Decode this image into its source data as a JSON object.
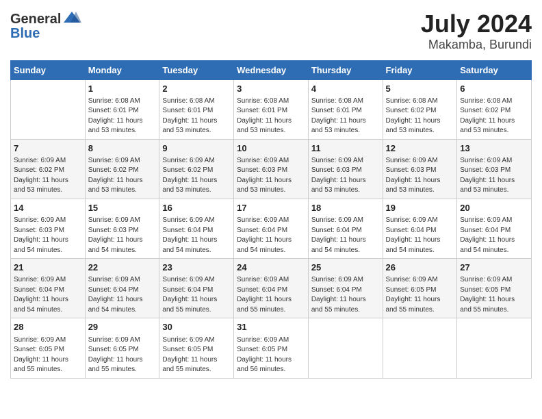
{
  "header": {
    "logo_general": "General",
    "logo_blue": "Blue",
    "month_year": "July 2024",
    "location": "Makamba, Burundi"
  },
  "days_of_week": [
    "Sunday",
    "Monday",
    "Tuesday",
    "Wednesday",
    "Thursday",
    "Friday",
    "Saturday"
  ],
  "weeks": [
    {
      "days": [
        {
          "num": "",
          "info": ""
        },
        {
          "num": "1",
          "info": "Sunrise: 6:08 AM\nSunset: 6:01 PM\nDaylight: 11 hours\nand 53 minutes."
        },
        {
          "num": "2",
          "info": "Sunrise: 6:08 AM\nSunset: 6:01 PM\nDaylight: 11 hours\nand 53 minutes."
        },
        {
          "num": "3",
          "info": "Sunrise: 6:08 AM\nSunset: 6:01 PM\nDaylight: 11 hours\nand 53 minutes."
        },
        {
          "num": "4",
          "info": "Sunrise: 6:08 AM\nSunset: 6:01 PM\nDaylight: 11 hours\nand 53 minutes."
        },
        {
          "num": "5",
          "info": "Sunrise: 6:08 AM\nSunset: 6:02 PM\nDaylight: 11 hours\nand 53 minutes."
        },
        {
          "num": "6",
          "info": "Sunrise: 6:08 AM\nSunset: 6:02 PM\nDaylight: 11 hours\nand 53 minutes."
        }
      ]
    },
    {
      "days": [
        {
          "num": "7",
          "info": "Sunrise: 6:09 AM\nSunset: 6:02 PM\nDaylight: 11 hours\nand 53 minutes."
        },
        {
          "num": "8",
          "info": "Sunrise: 6:09 AM\nSunset: 6:02 PM\nDaylight: 11 hours\nand 53 minutes."
        },
        {
          "num": "9",
          "info": "Sunrise: 6:09 AM\nSunset: 6:02 PM\nDaylight: 11 hours\nand 53 minutes."
        },
        {
          "num": "10",
          "info": "Sunrise: 6:09 AM\nSunset: 6:03 PM\nDaylight: 11 hours\nand 53 minutes."
        },
        {
          "num": "11",
          "info": "Sunrise: 6:09 AM\nSunset: 6:03 PM\nDaylight: 11 hours\nand 53 minutes."
        },
        {
          "num": "12",
          "info": "Sunrise: 6:09 AM\nSunset: 6:03 PM\nDaylight: 11 hours\nand 53 minutes."
        },
        {
          "num": "13",
          "info": "Sunrise: 6:09 AM\nSunset: 6:03 PM\nDaylight: 11 hours\nand 53 minutes."
        }
      ]
    },
    {
      "days": [
        {
          "num": "14",
          "info": "Sunrise: 6:09 AM\nSunset: 6:03 PM\nDaylight: 11 hours\nand 54 minutes."
        },
        {
          "num": "15",
          "info": "Sunrise: 6:09 AM\nSunset: 6:03 PM\nDaylight: 11 hours\nand 54 minutes."
        },
        {
          "num": "16",
          "info": "Sunrise: 6:09 AM\nSunset: 6:04 PM\nDaylight: 11 hours\nand 54 minutes."
        },
        {
          "num": "17",
          "info": "Sunrise: 6:09 AM\nSunset: 6:04 PM\nDaylight: 11 hours\nand 54 minutes."
        },
        {
          "num": "18",
          "info": "Sunrise: 6:09 AM\nSunset: 6:04 PM\nDaylight: 11 hours\nand 54 minutes."
        },
        {
          "num": "19",
          "info": "Sunrise: 6:09 AM\nSunset: 6:04 PM\nDaylight: 11 hours\nand 54 minutes."
        },
        {
          "num": "20",
          "info": "Sunrise: 6:09 AM\nSunset: 6:04 PM\nDaylight: 11 hours\nand 54 minutes."
        }
      ]
    },
    {
      "days": [
        {
          "num": "21",
          "info": "Sunrise: 6:09 AM\nSunset: 6:04 PM\nDaylight: 11 hours\nand 54 minutes."
        },
        {
          "num": "22",
          "info": "Sunrise: 6:09 AM\nSunset: 6:04 PM\nDaylight: 11 hours\nand 54 minutes."
        },
        {
          "num": "23",
          "info": "Sunrise: 6:09 AM\nSunset: 6:04 PM\nDaylight: 11 hours\nand 55 minutes."
        },
        {
          "num": "24",
          "info": "Sunrise: 6:09 AM\nSunset: 6:04 PM\nDaylight: 11 hours\nand 55 minutes."
        },
        {
          "num": "25",
          "info": "Sunrise: 6:09 AM\nSunset: 6:04 PM\nDaylight: 11 hours\nand 55 minutes."
        },
        {
          "num": "26",
          "info": "Sunrise: 6:09 AM\nSunset: 6:05 PM\nDaylight: 11 hours\nand 55 minutes."
        },
        {
          "num": "27",
          "info": "Sunrise: 6:09 AM\nSunset: 6:05 PM\nDaylight: 11 hours\nand 55 minutes."
        }
      ]
    },
    {
      "days": [
        {
          "num": "28",
          "info": "Sunrise: 6:09 AM\nSunset: 6:05 PM\nDaylight: 11 hours\nand 55 minutes."
        },
        {
          "num": "29",
          "info": "Sunrise: 6:09 AM\nSunset: 6:05 PM\nDaylight: 11 hours\nand 55 minutes."
        },
        {
          "num": "30",
          "info": "Sunrise: 6:09 AM\nSunset: 6:05 PM\nDaylight: 11 hours\nand 55 minutes."
        },
        {
          "num": "31",
          "info": "Sunrise: 6:09 AM\nSunset: 6:05 PM\nDaylight: 11 hours\nand 56 minutes."
        },
        {
          "num": "",
          "info": ""
        },
        {
          "num": "",
          "info": ""
        },
        {
          "num": "",
          "info": ""
        }
      ]
    }
  ]
}
